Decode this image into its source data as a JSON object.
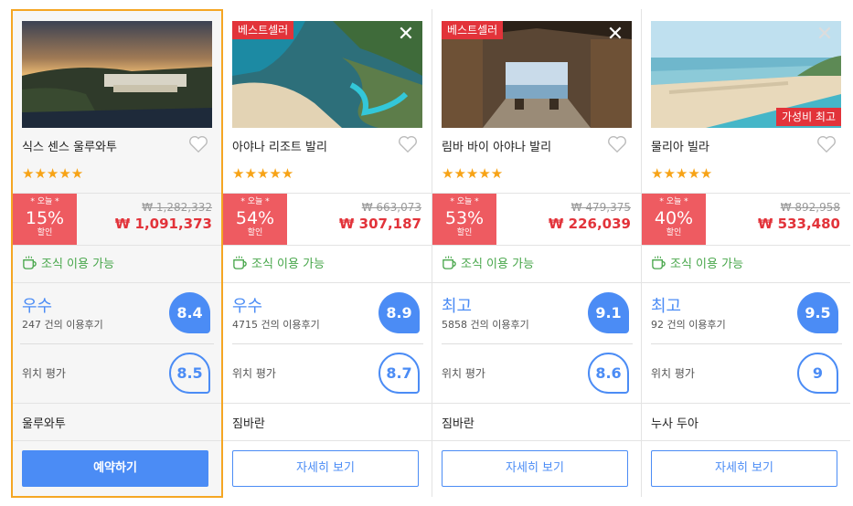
{
  "hotels": [
    {
      "name": "식스 센스 울루와투",
      "badge": "",
      "value_badge": "",
      "stars": "★★★★★",
      "deal_today": "* 오늘 *",
      "deal_pct": "15%",
      "deal_off": "할인",
      "original_price": "₩ 1,282,332",
      "price": "₩ 1,091,373",
      "breakfast": "조식 이용 가능",
      "grade": "우수",
      "reviews": "247 건의 이용후기",
      "score": "8.4",
      "location_label": "위치 평가",
      "location_score": "8.5",
      "area": "울루와투",
      "button": "예약하기",
      "selected": true
    },
    {
      "name": "아야나 리조트 발리",
      "badge": "베스트셀러",
      "value_badge": "",
      "stars": "★★★★★",
      "deal_today": "* 오늘 *",
      "deal_pct": "54%",
      "deal_off": "할인",
      "original_price": "₩ 663,073",
      "price": "₩ 307,187",
      "breakfast": "조식 이용 가능",
      "grade": "우수",
      "reviews": "4715 건의 이용후기",
      "score": "8.9",
      "location_label": "위치 평가",
      "location_score": "8.7",
      "area": "짐바란",
      "button": "자세히 보기",
      "selected": false
    },
    {
      "name": "림바 바이 아야나 발리",
      "badge": "베스트셀러",
      "value_badge": "",
      "stars": "★★★★★",
      "deal_today": "* 오늘 *",
      "deal_pct": "53%",
      "deal_off": "할인",
      "original_price": "₩ 479,375",
      "price": "₩ 226,039",
      "breakfast": "조식 이용 가능",
      "grade": "최고",
      "reviews": "5858 건의 이용후기",
      "score": "9.1",
      "location_label": "위치 평가",
      "location_score": "8.6",
      "area": "짐바란",
      "button": "자세히 보기",
      "selected": false
    },
    {
      "name": "물리아 빌라",
      "badge": "",
      "value_badge": "가성비 최고",
      "stars": "★★★★★",
      "deal_today": "* 오늘 *",
      "deal_pct": "40%",
      "deal_off": "할인",
      "original_price": "₩ 892,958",
      "price": "₩ 533,480",
      "breakfast": "조식 이용 가능",
      "grade": "최고",
      "reviews": "92 건의 이용후기",
      "score": "9.5",
      "location_label": "위치 평가",
      "location_score": "9",
      "area": "누사 두아",
      "button": "자세히 보기",
      "selected": false
    }
  ],
  "colors": {
    "accent_blue": "#4b8cf5",
    "deal_red": "#ee5b61",
    "price_red": "#e2333a",
    "star_orange": "#f7a316",
    "breakfast_green": "#47a64a",
    "selected_border": "#f5a623"
  },
  "icons": {
    "heart": "heart-icon",
    "close": "close-icon",
    "breakfast": "coffee-cup-icon",
    "star": "star-icon"
  }
}
